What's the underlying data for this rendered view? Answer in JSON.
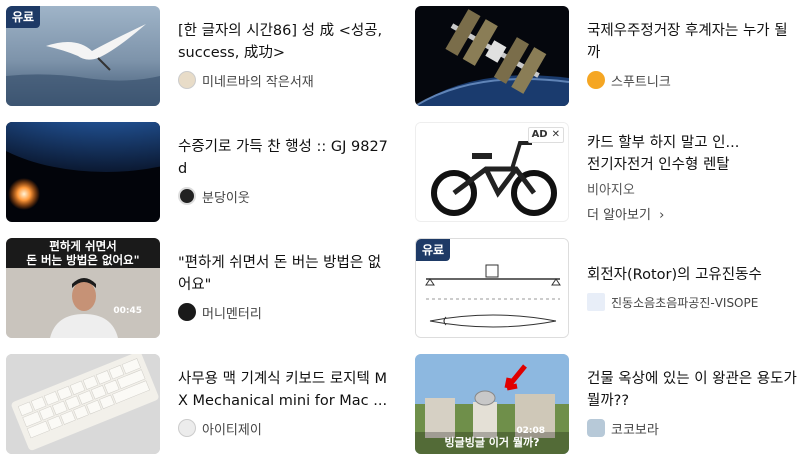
{
  "cards": [
    {
      "title": "[한 글자의 시간86] 성 成 <성공, success, 成功>",
      "source": "미네르바의 작은서재",
      "badge": "유료"
    },
    {
      "title": "국제우주정거장 후계자는 누가 될까",
      "source": "스푸트니크"
    },
    {
      "title": "수증기로 가득 찬 행성 :: GJ 9827 d",
      "source": "분당이웃"
    },
    {
      "title": "\"편하게 쉬면서 돈 버는 방법은 없어요\"",
      "source": "머니멘터리",
      "thumb_caption_1": "편하게 쉬면서",
      "thumb_caption_2": "돈 버는 방법은 없어요\"",
      "duration": "00:45"
    },
    {
      "title": "회전자(Rotor)의 고유진동수",
      "source": "진동소음초음파공진-VISOPE",
      "badge": "유료"
    },
    {
      "title": "사무용 맥 기계식 키보드 로지텍 MX Mechanical mini for Mac ...",
      "source": "아이티제이"
    },
    {
      "title": "건물 옥상에 있는 이 왕관은 용도가 뭘까??",
      "source": "코코보라",
      "thumb_caption": "빙글빙글 이거 뭘까?",
      "duration": "02:08"
    }
  ],
  "ad": {
    "line1": "카드 할부 하지 말고 인...",
    "line2": "전기자전거 인수형 렌탈",
    "brand": "비아지오",
    "more": "더 알아보기",
    "chevron": "›",
    "tag": "AD",
    "close": "✕"
  },
  "colors": {
    "badge_bg": "#1e3a66",
    "title": "#111111",
    "source": "#444444"
  }
}
